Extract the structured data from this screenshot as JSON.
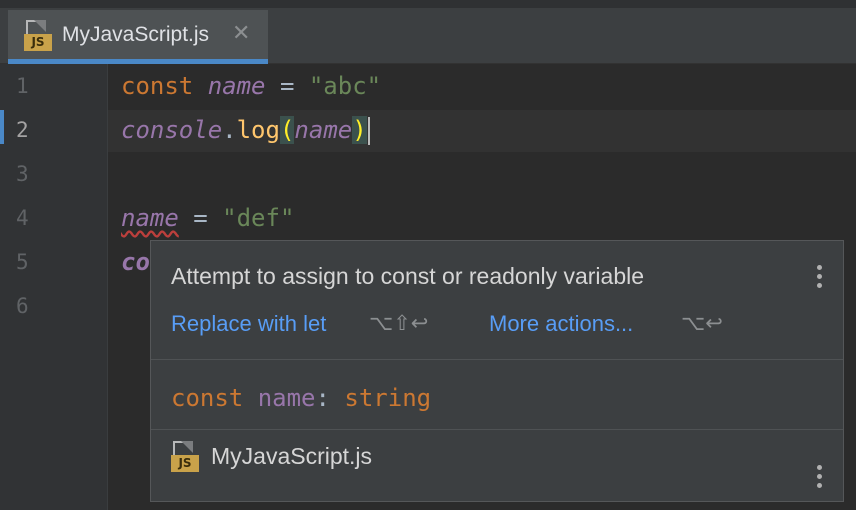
{
  "tab": {
    "filename": "MyJavaScript.js",
    "file_icon_badge": "JS",
    "close_glyph": "✕"
  },
  "gutter": {
    "line_numbers": [
      "1",
      "2",
      "3",
      "4",
      "5",
      "6"
    ],
    "active_line": "2"
  },
  "code": {
    "line1": {
      "keyword": "const",
      "name": "name",
      "op": " = ",
      "string": "\"abc\""
    },
    "line2": {
      "object": "console",
      "dot": ".",
      "method": "log",
      "open_paren": "(",
      "arg": "name",
      "close_paren": ")"
    },
    "line4": {
      "name": "name",
      "op": " = ",
      "string": "\"def\""
    },
    "line5": {
      "partial": "co"
    }
  },
  "popup": {
    "message": "Attempt to assign to const or readonly variable",
    "actions": [
      {
        "label": "Replace with let",
        "shortcut": "⌥⇧↩"
      },
      {
        "label": "More actions...",
        "shortcut": "⌥↩"
      }
    ],
    "signature": {
      "keyword": "const",
      "name": "name",
      "colon": ":",
      "type": "string"
    },
    "source_file": "MyJavaScript.js",
    "source_file_icon_badge": "JS"
  },
  "colors": {
    "keyword": "#cc7832",
    "variable": "#9876aa",
    "string": "#6a8759",
    "function": "#ffc66d",
    "link": "#589df6",
    "accent": "#4a88c7"
  }
}
